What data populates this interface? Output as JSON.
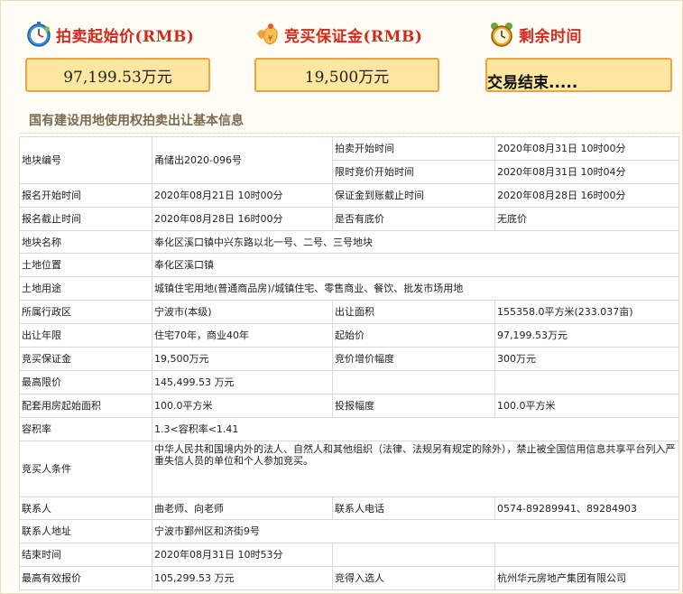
{
  "stats": [
    {
      "label": "拍卖起始价(RMB)",
      "value": "97,199.53万元",
      "icon": "stopwatch-icon"
    },
    {
      "label": "竞买保证金(RMB)",
      "value": "19,500万元",
      "icon": "gift-bag-icon"
    },
    {
      "label": "剩余时间",
      "value": "交易结束.....",
      "icon": "alarm-clock-icon"
    }
  ],
  "section_title": "国有建设用地使用权拍卖出让基本信息",
  "rows": {
    "plot_no": {
      "label": "地块编号",
      "value": "甬储出2020-096号"
    },
    "auction_start": {
      "label": "拍卖开始时间",
      "value": "2020年08月31日 10时00分"
    },
    "limited_bid_start": {
      "label": "限时竞价开始时间",
      "value": "2020年08月31日 10时04分"
    },
    "reg_start": {
      "label": "报名开始时间",
      "value": "2020年08月21日 10时00分"
    },
    "deposit_deadline": {
      "label": "保证金到账截止时间",
      "value": "2020年08月28日 16时00分"
    },
    "reg_end": {
      "label": "报名截止时间",
      "value": "2020年08月28日 16时00分"
    },
    "reserve": {
      "label": "是否有底价",
      "value": "无底价"
    },
    "plot_name": {
      "label": "地块名称",
      "value": "奉化区溪口镇中兴东路以北一号、二号、三号地块"
    },
    "location": {
      "label": "土地位置",
      "value": "奉化区溪口镇"
    },
    "usage": {
      "label": "土地用途",
      "value": "城镇住宅用地(普通商品房)/城镇住宅、零售商业、餐饮、批发市场用地"
    },
    "district": {
      "label": "所属行政区",
      "value": "宁波市(本级)"
    },
    "area": {
      "label": "出让面积",
      "value": "155358.0平方米(233.037亩)"
    },
    "term": {
      "label": "出让年限",
      "value": "住宅70年，商业40年"
    },
    "start_price": {
      "label": "起始价",
      "value": "97,199.53万元"
    },
    "deposit": {
      "label": "竞买保证金",
      "value": "19,500万元"
    },
    "increment": {
      "label": "竞价增价幅度",
      "value": "300万元"
    },
    "max_price": {
      "label": "最高限价",
      "value": "145,499.53 万元"
    },
    "housing_area": {
      "label": "配套用房起始面积",
      "value": "100.0平方米"
    },
    "housing_inc": {
      "label": "投报幅度",
      "value": "100.0平方米"
    },
    "far": {
      "label": "容积率",
      "value": "1.3<容积率<1.41"
    },
    "conditions": {
      "label": "竞买人条件",
      "value": "中华人民共和国境内外的法人、自然人和其他组织（法律、法规另有规定的除外），禁止被全国信用信息共享平台列入严重失信人员的单位和个人参加竞买。"
    },
    "contact": {
      "label": "联系人",
      "value": "曲老师、向老师"
    },
    "phone": {
      "label": "联系人电话",
      "value": "0574-89289941、89284903"
    },
    "address": {
      "label": "联系人地址",
      "value": "宁波市鄞州区和济街9号"
    },
    "end_time": {
      "label": "结束时间",
      "value": "2020年08月31日 10时53分"
    },
    "top_bid": {
      "label": "最高有效报价",
      "value": "105,299.53 万元"
    },
    "winner": {
      "label": "竞得入选人",
      "value": "杭州华元房地产集团有限公司"
    }
  }
}
